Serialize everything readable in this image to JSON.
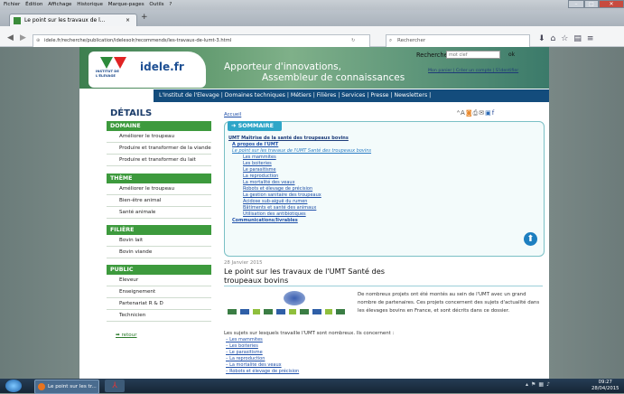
{
  "browser": {
    "menus": [
      "Fichier",
      "Édition",
      "Affichage",
      "Historique",
      "Marque-pages",
      "Outils",
      "?"
    ],
    "tab_title": "Le point sur les travaux de l...",
    "tab_close": "×",
    "new_tab": "+",
    "url": "idele.fr/recherche/publication/idelesolr/recommends/les-travaux-de-lumt-3.html",
    "search_placeholder": "Rechercher"
  },
  "site": {
    "logo_text": "idele.fr",
    "logo_org": "INSTITUT DE L'ÉLEVAGE",
    "tagline1": "Apporteur d'innovations,",
    "tagline2": "Assembleur de connaissances",
    "search_label": "Rechercher",
    "search_value": "mot clef",
    "search_ok": "ok",
    "top_links": "Mon panier  |  Créer un compte  |  S'identifier",
    "nav": "L'Institut de l'Elevage | Domaines techniques | Métiers | Filières | Services | Presse | Newsletters |"
  },
  "sidebar": {
    "title": "DÉTAILS",
    "sections": [
      {
        "heading": "DOMAINE",
        "items": [
          "Améliorer le troupeau",
          "Produire et transformer de la viande",
          "Produire et transformer du lait"
        ]
      },
      {
        "heading": "THÈME",
        "items": [
          "Améliorer le troupeau",
          "Bien-être animal",
          "Santé animale"
        ]
      },
      {
        "heading": "FILIÈRE",
        "items": [
          "Bovin lait",
          "Bovin viande"
        ]
      },
      {
        "heading": "PUBLIC",
        "items": [
          "Eleveur",
          "Enseignement",
          "Partenariat R & D",
          "Technicien"
        ]
      }
    ],
    "back": "retour"
  },
  "main": {
    "breadcrumb": "Accueil",
    "sommaire_label": "SOMMAIRE",
    "toc_title": "UMT Maîtrise de la santé des troupeaux bovins",
    "toc_items": [
      "A propos de l'UMT",
      "Le point sur les travaux de l'UMT Santé des troupeaux bovins",
      "Les mammites",
      "Les boiteries",
      "Le parasitisme",
      "La reproduction",
      "La mortalité des veaux",
      "Robots et élevage de précision",
      "La gestion sanitaire des troupeaux",
      "Acidose sub-aiguë du rumen",
      "Bâtiments et santé des animaux",
      "Utilisation des antibiotiques",
      "Communications/livrables"
    ],
    "date": "28 Janvier 2015",
    "article_title": "Le point sur les travaux de l'UMT Santé des troupeaux bovins",
    "intro": "De nombreux projets ont été montés au sein de l'UMT avec un grand nombre de partenaires. Ces projets concernent des sujets d'actualité dans les élevages bovins en France, et sont décrits dans ce dossier.",
    "subjects_intro": "Les sujets sur lesquels travaille l'UMT sont nombreux. Ils concernent :",
    "subjects": [
      "Les mammites",
      "Les boiteries",
      "Le parasitisme",
      "La reproduction",
      "La mortalité des veaux",
      "Robots et élevage de précision"
    ]
  },
  "taskbar": {
    "task": "Le point sur les tr...",
    "time": "09:27",
    "date": "28/04/2015"
  }
}
